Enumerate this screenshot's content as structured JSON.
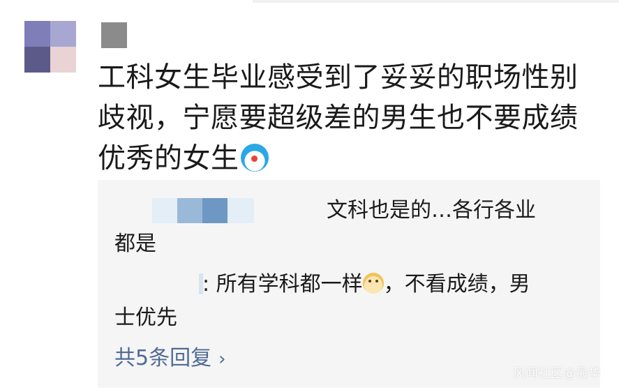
{
  "post": {
    "text": "工科女生毕业感受到了妥妥的职场性别歧视，宁愿要超级差的男生也不要成绩优秀的女生",
    "emoji": "doraemon-emoji"
  },
  "replies": [
    {
      "text": "文科也是的…各行各业",
      "continuation": "都是"
    },
    {
      "text_prefix": ": 所有学科都一样",
      "emoji": "doge-emoji",
      "text_suffix": "，不看成绩，男",
      "continuation": "士优先"
    }
  ],
  "view_more": {
    "label": "共5条回复"
  },
  "watermark": "风闻社区@最华"
}
